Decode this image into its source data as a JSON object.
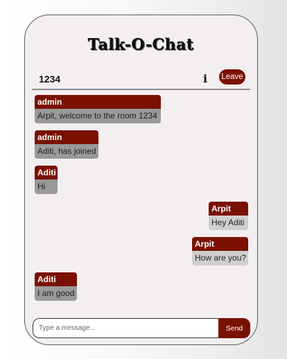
{
  "app": {
    "title": "Talk-O-Chat"
  },
  "room": {
    "name": "1234",
    "info_icon": "i",
    "leave_label": "Leave"
  },
  "messages": [
    {
      "sender": "admin",
      "text": "Arpit, welcome to the room 1234",
      "side": "left"
    },
    {
      "sender": "admin",
      "text": "Aditi, has joined",
      "side": "left"
    },
    {
      "sender": "Aditi",
      "text": "Hi",
      "side": "left"
    },
    {
      "sender": "Arpit",
      "text": "Hey Aditi",
      "side": "right"
    },
    {
      "sender": "Arpit",
      "text": "How are you?",
      "side": "right"
    },
    {
      "sender": "Aditi",
      "text": "I am good",
      "side": "left"
    }
  ],
  "composer": {
    "placeholder": "Type a message...",
    "value": "",
    "send_label": "Send"
  },
  "colors": {
    "accent": "#7a1100",
    "left_bubble": "#999999",
    "right_bubble": "#cfcfcf",
    "card": "#f3eff1"
  }
}
